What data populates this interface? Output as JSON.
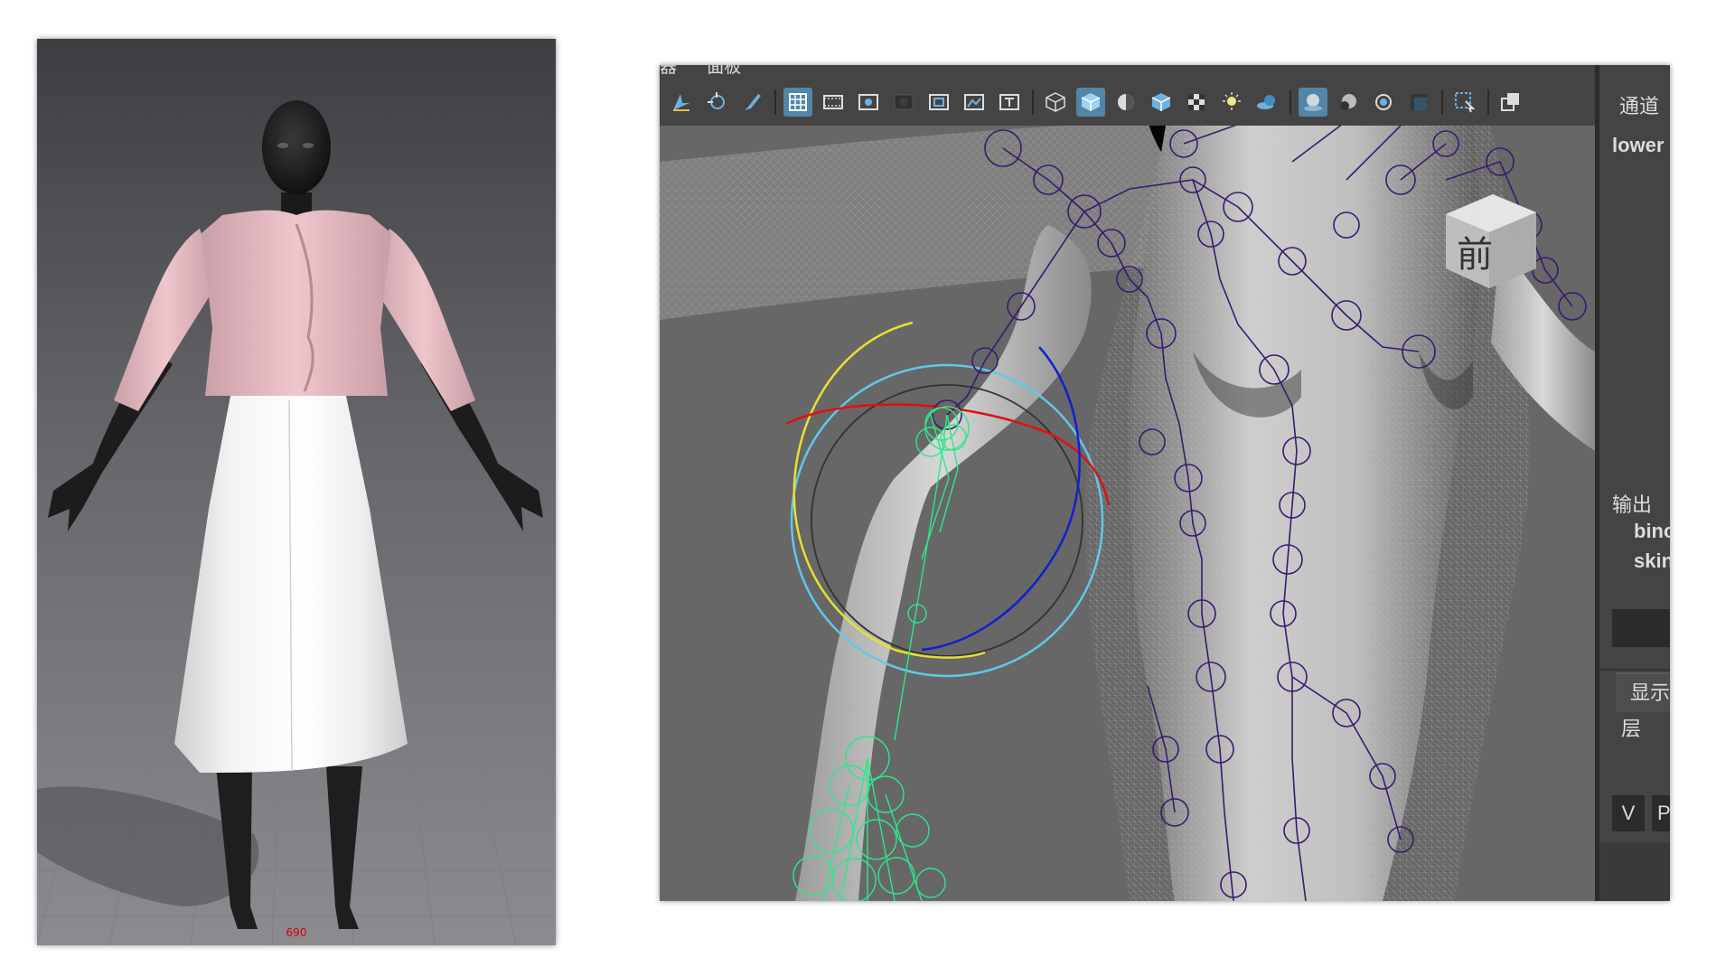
{
  "garment_preview": {
    "size_label": "690"
  },
  "maya": {
    "menu": [
      "器",
      "面板"
    ],
    "toolbar": [
      {
        "icon": "select-camera-icon",
        "active": false
      },
      {
        "icon": "tumble-camera-icon",
        "active": false
      },
      {
        "icon": "paint-brush-icon",
        "active": false
      },
      {
        "separator": true
      },
      {
        "icon": "grid-icon",
        "active": true
      },
      {
        "icon": "film-gate-icon",
        "active": false
      },
      {
        "icon": "resolution-gate-icon",
        "active": false
      },
      {
        "icon": "gate-mask-icon",
        "active": false
      },
      {
        "icon": "field-chart-icon",
        "active": false
      },
      {
        "icon": "safe-action-icon",
        "active": false
      },
      {
        "icon": "safe-title-icon",
        "active": false
      },
      {
        "separator": true
      },
      {
        "icon": "wireframe-icon",
        "active": false
      },
      {
        "icon": "smooth-shade-icon",
        "active": true
      },
      {
        "icon": "default-material-icon",
        "active": false
      },
      {
        "icon": "wireframe-on-shaded-icon",
        "active": false
      },
      {
        "icon": "textured-icon",
        "active": false
      },
      {
        "icon": "lights-icon",
        "active": false
      },
      {
        "icon": "shadows-icon",
        "active": false
      },
      {
        "separator": true
      },
      {
        "icon": "xray-icon",
        "active": true
      },
      {
        "icon": "xray-active-components-icon",
        "active": false
      },
      {
        "icon": "xray-joints-icon",
        "active": false
      },
      {
        "icon": "screen-space-ao-icon",
        "active": false
      },
      {
        "separator": true
      },
      {
        "icon": "isolate-select-icon",
        "active": false
      },
      {
        "separator": true
      },
      {
        "icon": "two-side-lighting-icon",
        "active": false
      }
    ],
    "viewcube_face": "前",
    "colors": {
      "active_button": "#5285a6",
      "joint_color": "#3a1a6e",
      "selected_joint_color": "#2ee88a",
      "rotate_x": "#e01010",
      "rotate_y": "#e8e030",
      "rotate_z": "#1020d0",
      "rotate_view_ring": "#60c8e8"
    }
  },
  "channel_box": {
    "tab_channels": "通道",
    "node_name": "lower",
    "output_label": "输出",
    "outputs": [
      "binc",
      "skin"
    ],
    "display_tab": "显示",
    "layers_label": "层",
    "v_button": "V",
    "p_button": "P"
  }
}
